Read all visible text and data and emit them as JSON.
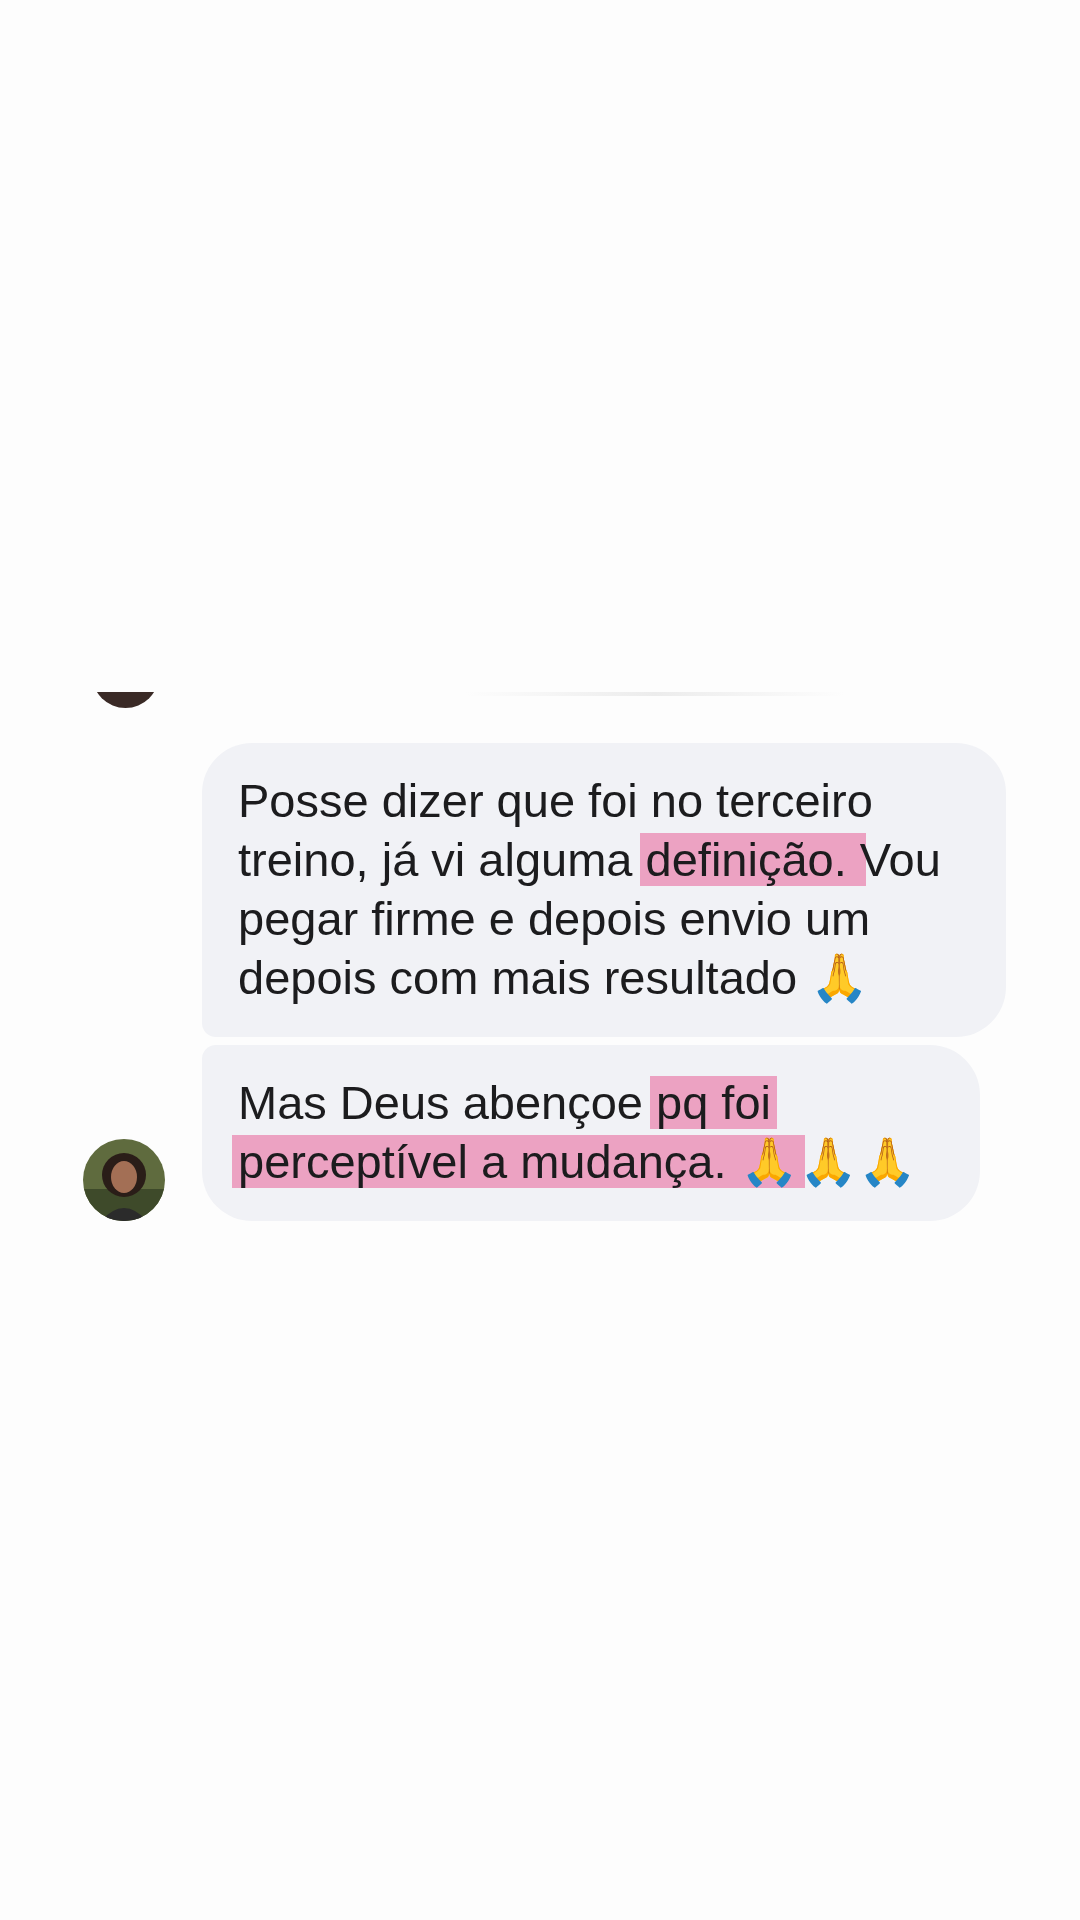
{
  "messages": [
    {
      "parts": [
        {
          "text": "Posse dizer que foi no terceiro treino, já vi alguma ",
          "highlighted": false
        },
        {
          "text": "definição. ",
          "highlighted": true
        },
        {
          "text": " Vou pegar firme e depois envio um depois com mais resultado 🙏",
          "highlighted": false
        }
      ],
      "avatar": false
    },
    {
      "parts": [
        {
          "text": "Mas Deus abençoe ",
          "highlighted": false
        },
        {
          "text": "pq foi perceptível a mudança. 🙏",
          "highlighted": true
        },
        {
          "text": "🙏🙏",
          "highlighted": false
        }
      ],
      "avatar": true
    }
  ]
}
